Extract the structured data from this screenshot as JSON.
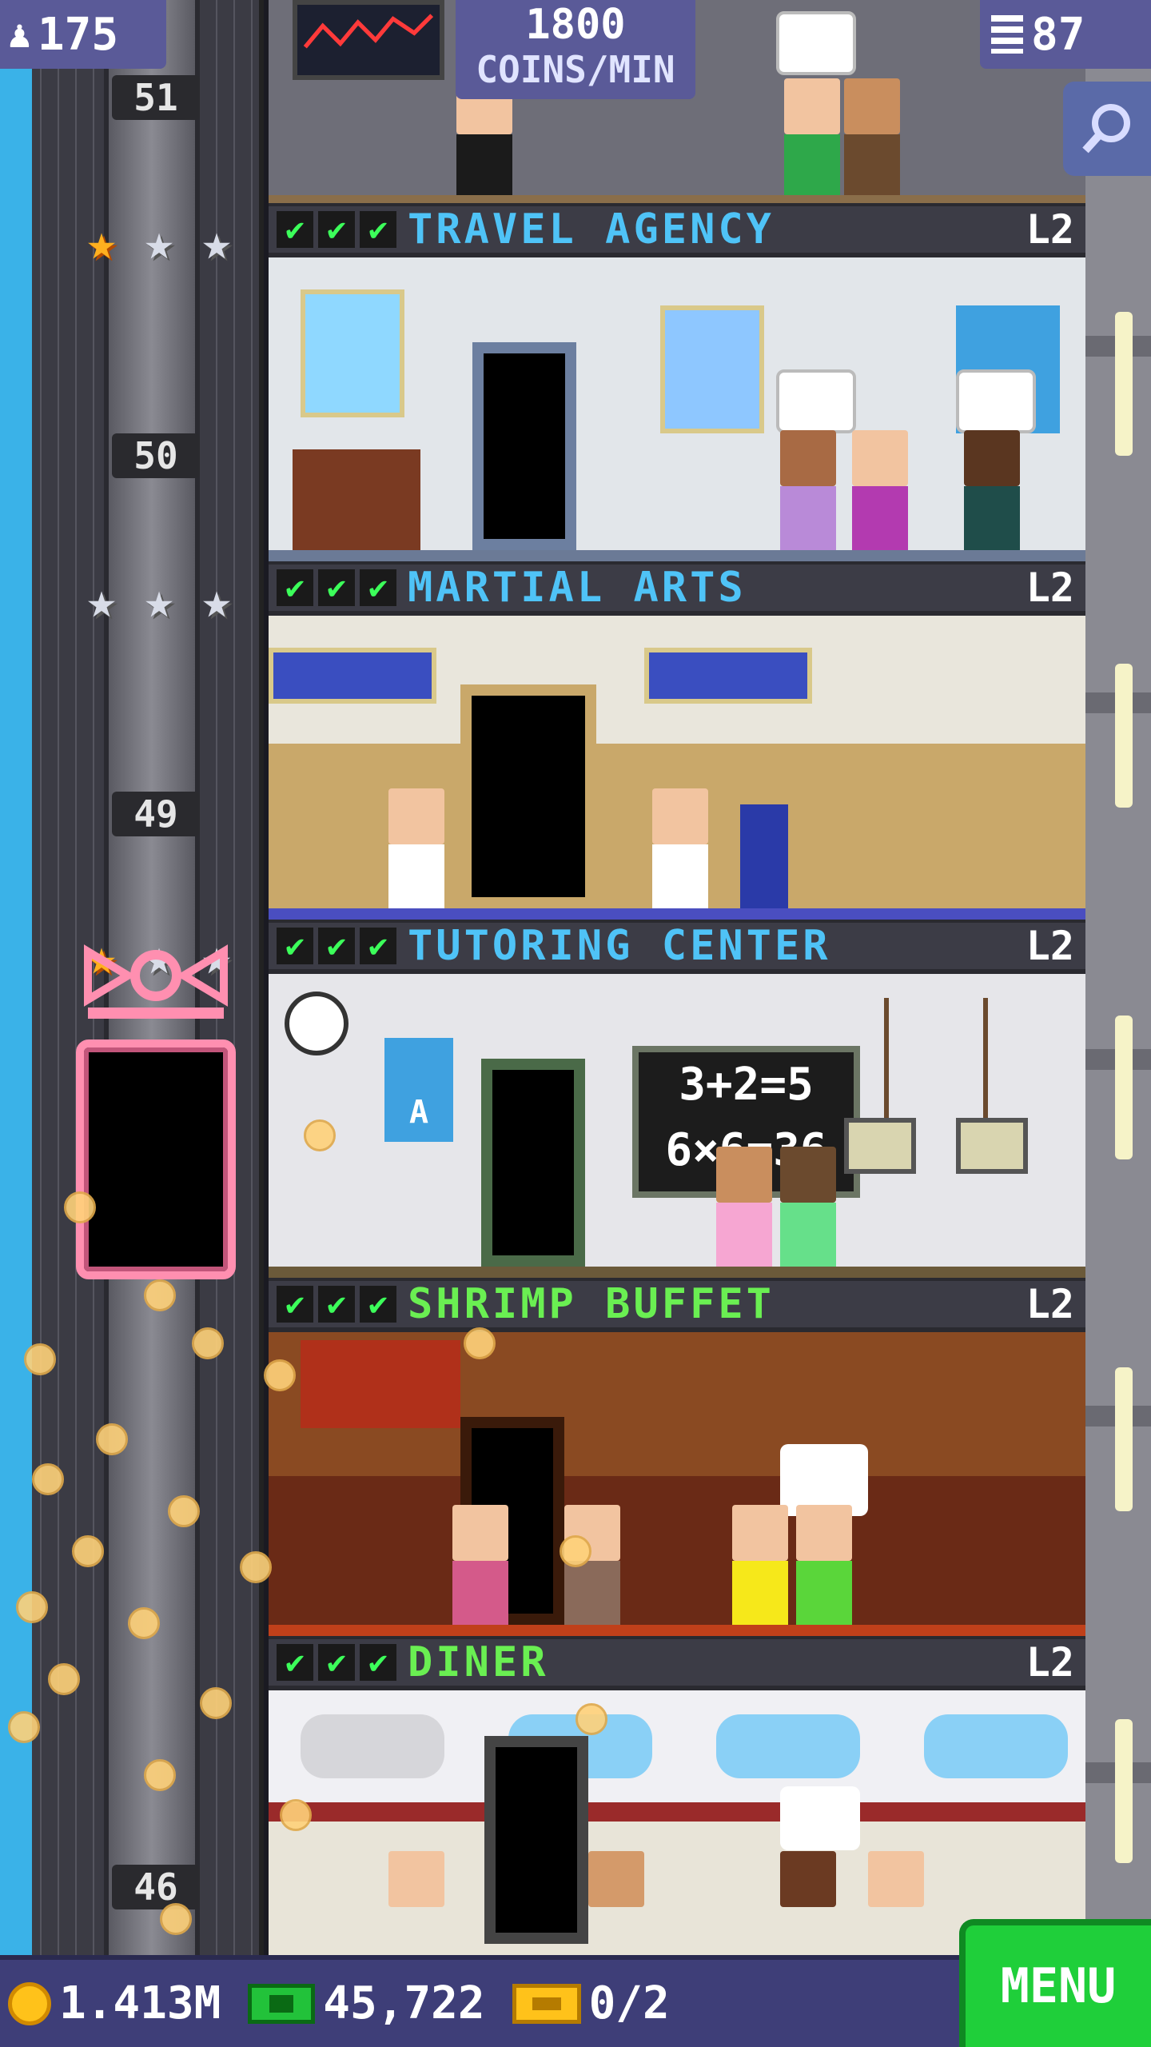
{
  "hud": {
    "residents": "175",
    "coins_per_min_value": "1800",
    "coins_per_min_label": "COINS/MIN",
    "floors_count": "87"
  },
  "bottom_bar": {
    "coins": "1.413M",
    "tower_bux": "45,722",
    "tickets": "0/2",
    "menu_label": "MENU"
  },
  "elevator": {
    "floor_numbers": [
      "51",
      "50",
      "49",
      "46"
    ]
  },
  "floors": [
    {
      "name": "TRAVEL AGENCY",
      "level": "L2",
      "color": "#4fc3f7",
      "stars": [
        "gold",
        "silver",
        "silver"
      ]
    },
    {
      "name": "MARTIAL ARTS",
      "level": "L2",
      "color": "#4fc3f7",
      "stars": [
        "silver",
        "silver",
        "silver"
      ]
    },
    {
      "name": "TUTORING CENTER",
      "level": "L2",
      "color": "#4fc3f7",
      "stars": [
        "gold",
        "silver",
        "silver"
      ]
    },
    {
      "name": "SHRIMP BUFFET",
      "level": "L2",
      "color": "#6aef52",
      "stars": []
    },
    {
      "name": "DINER",
      "level": "L2",
      "color": "#6aef52",
      "stars": []
    }
  ],
  "chalkboard": {
    "line1": "3+2=5",
    "line2": "6×6=36"
  },
  "poster_letter": "A",
  "colors": {
    "hud_bg": "#5a5a98",
    "bottom_bg": "#3e3e78",
    "menu_green": "#1fcf3a",
    "coin_gold": "#ffc21a"
  }
}
